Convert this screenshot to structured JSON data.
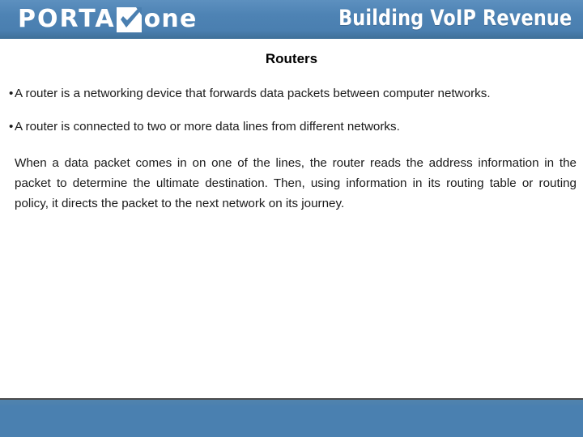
{
  "header": {
    "logo": {
      "text_before": "PORTA",
      "mark_icon": "checkmark-square-icon",
      "text_after": "one"
    },
    "tagline": "Building VoIP Revenue",
    "background_color": "#4a7fb0",
    "text_color": "#ffffff"
  },
  "slide": {
    "title": "Routers",
    "title_color": "#000000",
    "background_color": "#ffffff",
    "body_text_color": "#1a1a1a",
    "paragraphs": [
      {
        "bullet": "•",
        "has_bullet": true,
        "text": "A router is a networking device that forwards data packets between computer networks."
      },
      {
        "bullet": "•",
        "has_bullet": true,
        "text": "A router is connected to two or more data lines from different networks."
      },
      {
        "bullet": "",
        "has_bullet": false,
        "text": "When a data packet comes in on one of the lines, the router reads the address information in the packet to determine the ultimate destination. Then, using information in its routing table or routing policy, it directs the packet to the next network on its journey."
      }
    ]
  },
  "footer": {
    "background_color": "#4a80b0",
    "rule_color": "#4b4b4b",
    "text": ""
  }
}
